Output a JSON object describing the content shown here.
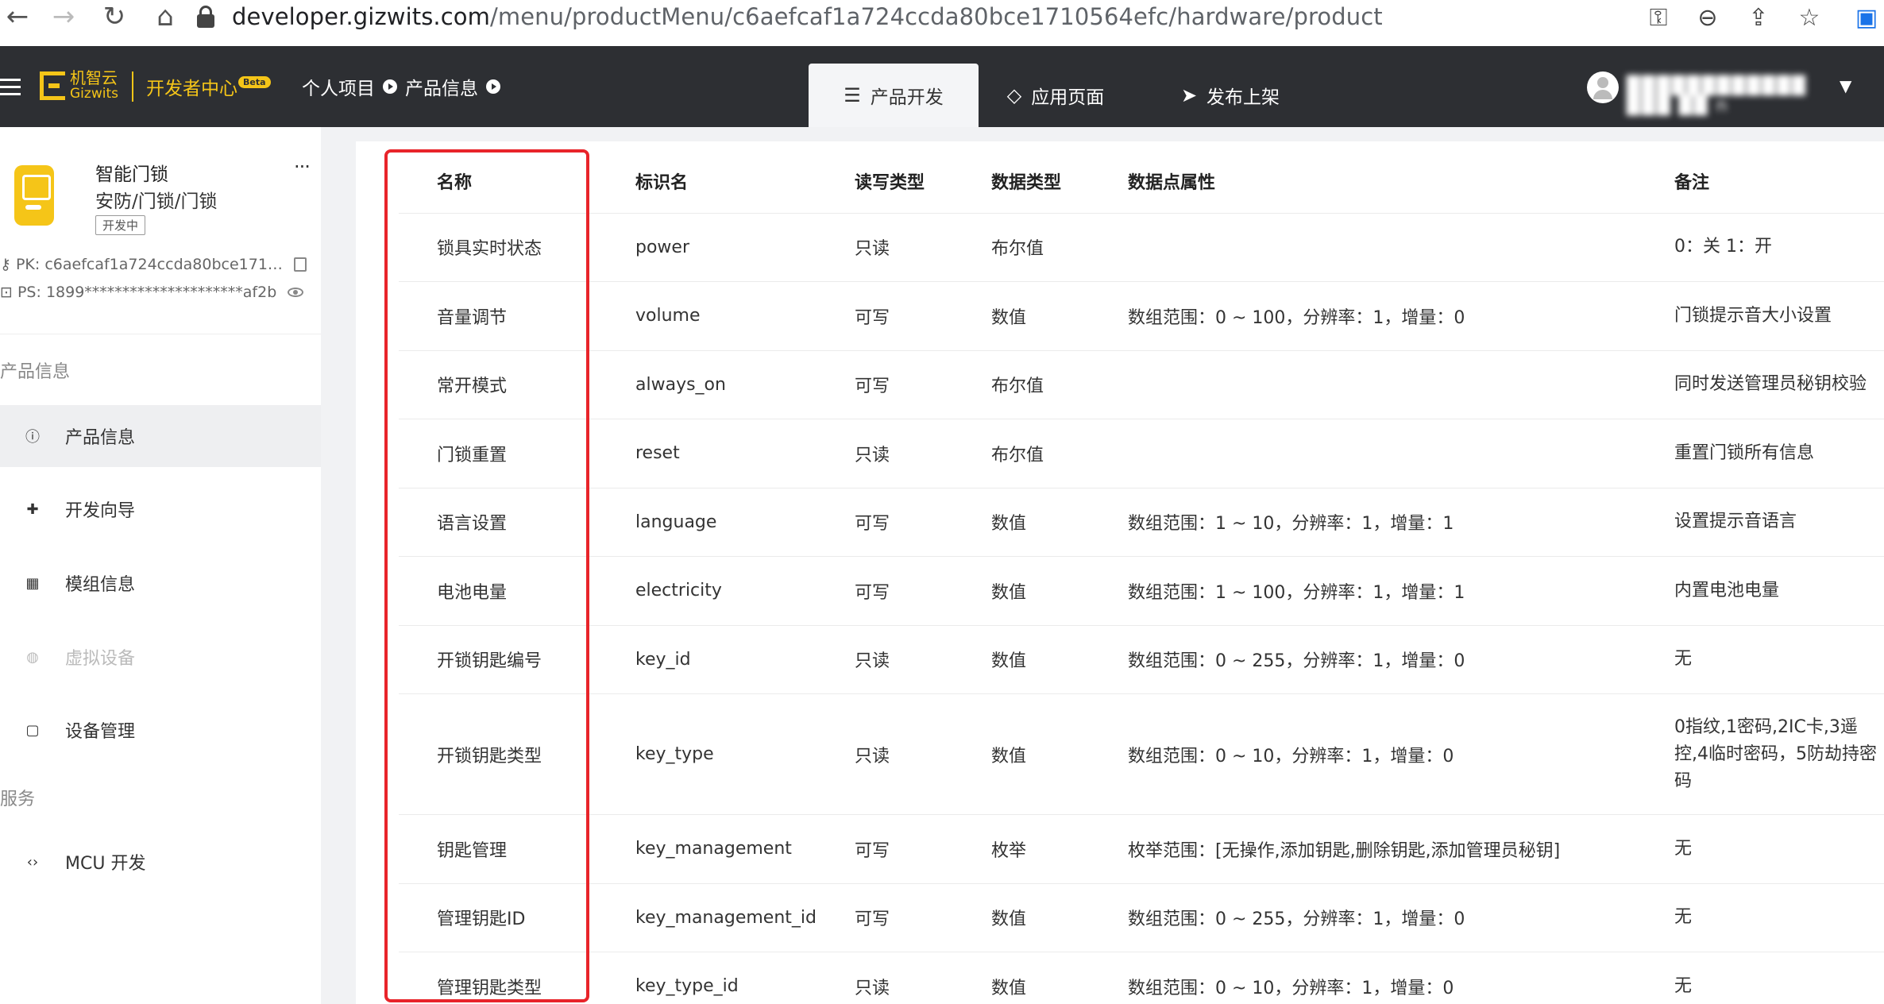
{
  "browser": {
    "url_host": "developer.gizwits.com",
    "url_path": "/menu/productMenu/c6aefcaf1a724ccda80bce1710564efc/hardware/product"
  },
  "header": {
    "logo_cn": "机智云",
    "logo_en": "Gizwits",
    "dev_center": "开发者中心",
    "beta": "Beta",
    "breadcrumb": [
      "个人项目",
      "产品信息"
    ],
    "tabs": [
      {
        "label": "产品开发",
        "icon": "sliders-icon",
        "active": true
      },
      {
        "label": "应用页面",
        "icon": "diamond-icon",
        "active": false
      },
      {
        "label": "发布上架",
        "icon": "send-icon",
        "active": false
      }
    ],
    "username": "████████████ ███ ██ n",
    "colors": {
      "header_bg": "#2d2f33",
      "brand": "#f5c518",
      "highlight": "#e8242a"
    }
  },
  "sidebar": {
    "product_name": "智能门锁",
    "product_category": "安防/门锁/门锁",
    "product_status": "开发中",
    "more": "···",
    "pk_label": "PK:",
    "pk_value": "c6aefcaf1a724ccda80bce171…",
    "ps_label": "PS:",
    "ps_value": "1899*********************af2b",
    "section_product": "产品信息",
    "section_service": "服务",
    "items": [
      {
        "label": "产品信息",
        "icon": "info-icon",
        "active": true,
        "disabled": false
      },
      {
        "label": "开发向导",
        "icon": "signpost-icon",
        "active": false,
        "disabled": false
      },
      {
        "label": "模组信息",
        "icon": "grid-icon",
        "active": false,
        "disabled": false
      },
      {
        "label": "虚拟设备",
        "icon": "virtual-device-icon",
        "active": false,
        "disabled": true
      },
      {
        "label": "设备管理",
        "icon": "clipboard-icon",
        "active": false,
        "disabled": false
      }
    ],
    "service_items": [
      {
        "label": "MCU 开发",
        "icon": "code-icon"
      }
    ]
  },
  "table": {
    "headers": [
      "名称",
      "标识名",
      "读写类型",
      "数据类型",
      "数据点属性",
      "备注"
    ],
    "rows": [
      [
        "锁具实时状态",
        "power",
        "只读",
        "布尔值",
        "",
        "0：关 1：开"
      ],
      [
        "音量调节",
        "volume",
        "可写",
        "数值",
        "数组范围：0 ~ 100，分辨率：1，增量：0",
        "门锁提示音大小设置"
      ],
      [
        "常开模式",
        "always_on",
        "可写",
        "布尔值",
        "",
        "同时发送管理员秘钥校验"
      ],
      [
        "门锁重置",
        "reset",
        "只读",
        "布尔值",
        "",
        "重置门锁所有信息"
      ],
      [
        "语言设置",
        "language",
        "可写",
        "数值",
        "数组范围：1 ~ 10，分辨率：1，增量：1",
        "设置提示音语言"
      ],
      [
        "电池电量",
        "electricity",
        "可写",
        "数值",
        "数组范围：1 ~ 100，分辨率：1，增量：1",
        "内置电池电量"
      ],
      [
        "开锁钥匙编号",
        "key_id",
        "只读",
        "数值",
        "数组范围：0 ~ 255，分辨率：1，增量：0",
        "无"
      ],
      [
        "开锁钥匙类型",
        "key_type",
        "只读",
        "数值",
        "数组范围：0 ~ 10，分辨率：1，增量：0",
        "0指纹,1密码,2IC卡,3遥控,4临时密码，5防劫持密码"
      ],
      [
        "钥匙管理",
        "key_management",
        "可写",
        "枚举",
        "枚举范围：[无操作,添加钥匙,删除钥匙,添加管理员秘钥]",
        "无"
      ],
      [
        "管理钥匙ID",
        "key_management_id",
        "可写",
        "数值",
        "数组范围：0 ~ 255，分辨率：1，增量：0",
        "无"
      ],
      [
        "管理钥匙类型",
        "key_type_id",
        "只读",
        "数值",
        "数组范围：0 ~ 10，分辨率：1，增量：0",
        "无"
      ]
    ]
  }
}
